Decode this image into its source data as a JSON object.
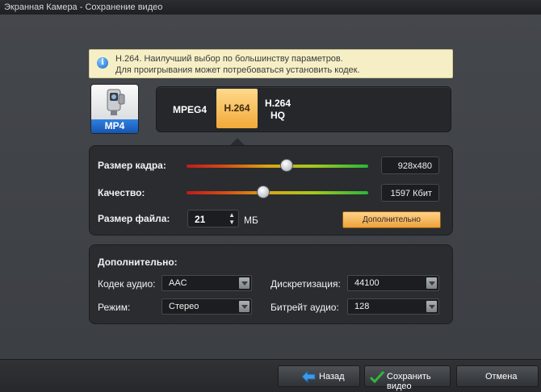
{
  "window": {
    "title": "Экранная Камера - Сохранение видео"
  },
  "info": {
    "line1": "H.264. Наилучший выбор по большинству параметров.",
    "line2": "Для проигрывания может потребоваться установить кодек.",
    "icon": "info-icon"
  },
  "format": {
    "badge": "MP4",
    "icon": "video-camera-icon"
  },
  "codecs": [
    {
      "label": "MPEG4",
      "selected": false
    },
    {
      "label": "H.264",
      "selected": true
    },
    {
      "label_line1": "H.264",
      "label_line2": "HQ",
      "selected": false
    }
  ],
  "settings": {
    "frame_size": {
      "label": "Размер кадра:",
      "value": "928x480",
      "level": 0.55
    },
    "quality": {
      "label": "Качество:",
      "value": "1597 Кбит",
      "level": 0.42
    },
    "file_size": {
      "label": "Размер файла:",
      "value": "21",
      "unit": "МБ"
    },
    "advanced_button": "Дополнительно"
  },
  "advanced": {
    "title": "Дополнительно:",
    "audio_codec": {
      "label": "Кодек аудио:",
      "value": "AAC"
    },
    "mode": {
      "label": "Режим:",
      "value": "Стерео"
    },
    "sampling": {
      "label": "Дискретизация:",
      "value": "44100"
    },
    "audio_bitrate": {
      "label": "Битрейт аудио:",
      "value": "128"
    }
  },
  "buttons": {
    "back": "Назад",
    "save": "Сохранить видео",
    "cancel": "Отмена"
  },
  "colors": {
    "accent_orange": "#f2a93a",
    "badge_blue": "#1f6fd6",
    "save_check": "#31b53c",
    "back_arrow": "#3d9be8"
  }
}
